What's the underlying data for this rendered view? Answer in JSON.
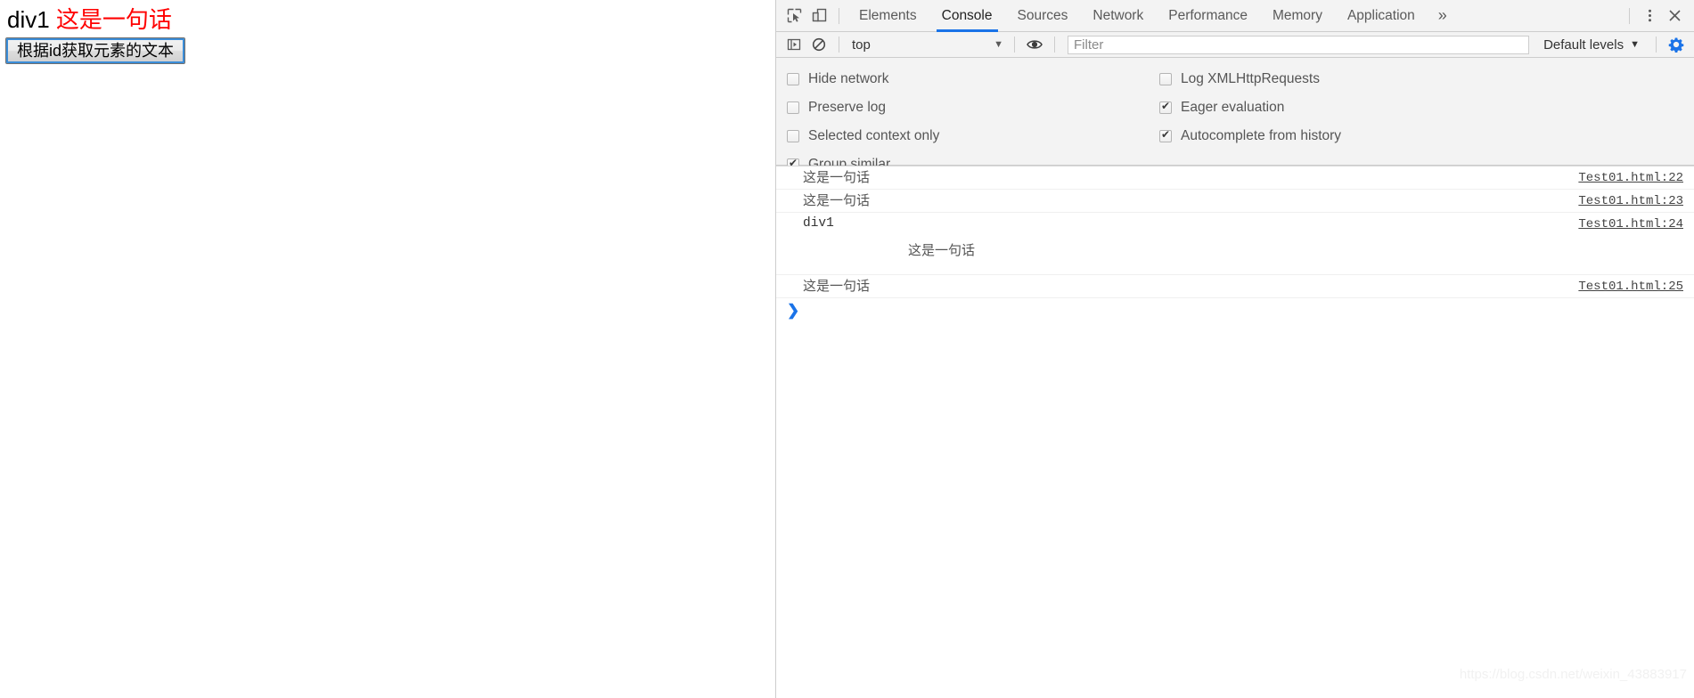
{
  "page": {
    "heading_plain": "div1 ",
    "heading_red": "这是一句话",
    "button_label": "根据id获取元素的文本"
  },
  "devtools": {
    "toolbar": {
      "inspect_icon": "inspect-cursor-icon",
      "device_icon": "device-toolbar-icon",
      "more_tabs_label": "»",
      "kebab_icon": "more-options-icon",
      "close_icon": "close-icon",
      "tabs": [
        {
          "label": "Elements",
          "active": false
        },
        {
          "label": "Console",
          "active": true
        },
        {
          "label": "Sources",
          "active": false
        },
        {
          "label": "Network",
          "active": false
        },
        {
          "label": "Performance",
          "active": false
        },
        {
          "label": "Memory",
          "active": false
        },
        {
          "label": "Application",
          "active": false
        }
      ]
    },
    "filterbar": {
      "sidebar_icon": "console-sidebar-icon",
      "clear_icon": "clear-console-icon",
      "context_value": "top",
      "context_caret": "▼",
      "eye_icon": "live-expression-icon",
      "filter_placeholder": "Filter",
      "filter_value": "",
      "levels_label": "Default levels",
      "levels_caret": "▼",
      "settings_icon": "settings-gear-icon",
      "settings_icon_color": "#1a73e8"
    },
    "settings": {
      "left": [
        {
          "label": "Hide network",
          "checked": false
        },
        {
          "label": "Preserve log",
          "checked": false
        },
        {
          "label": "Selected context only",
          "checked": false
        },
        {
          "label": "Group similar",
          "checked": true
        }
      ],
      "right": [
        {
          "label": "Log XMLHttpRequests",
          "checked": false
        },
        {
          "label": "Eager evaluation",
          "checked": true
        },
        {
          "label": "Autocomplete from history",
          "checked": true
        }
      ]
    },
    "console": {
      "messages": [
        {
          "text": "这是一句话",
          "mono": false,
          "sub": "",
          "source": "Test01.html:22",
          "tall": false
        },
        {
          "text": "这是一句话",
          "mono": false,
          "sub": "",
          "source": "Test01.html:23",
          "tall": false
        },
        {
          "text": "div1",
          "mono": true,
          "sub": "这是一句话",
          "source": "Test01.html:24",
          "tall": true
        },
        {
          "text": "这是一句话",
          "mono": false,
          "sub": "",
          "source": "Test01.html:25",
          "tall": false
        }
      ],
      "prompt_caret": "❯"
    }
  },
  "watermark": "https://blog.csdn.net/weixin_43883917"
}
